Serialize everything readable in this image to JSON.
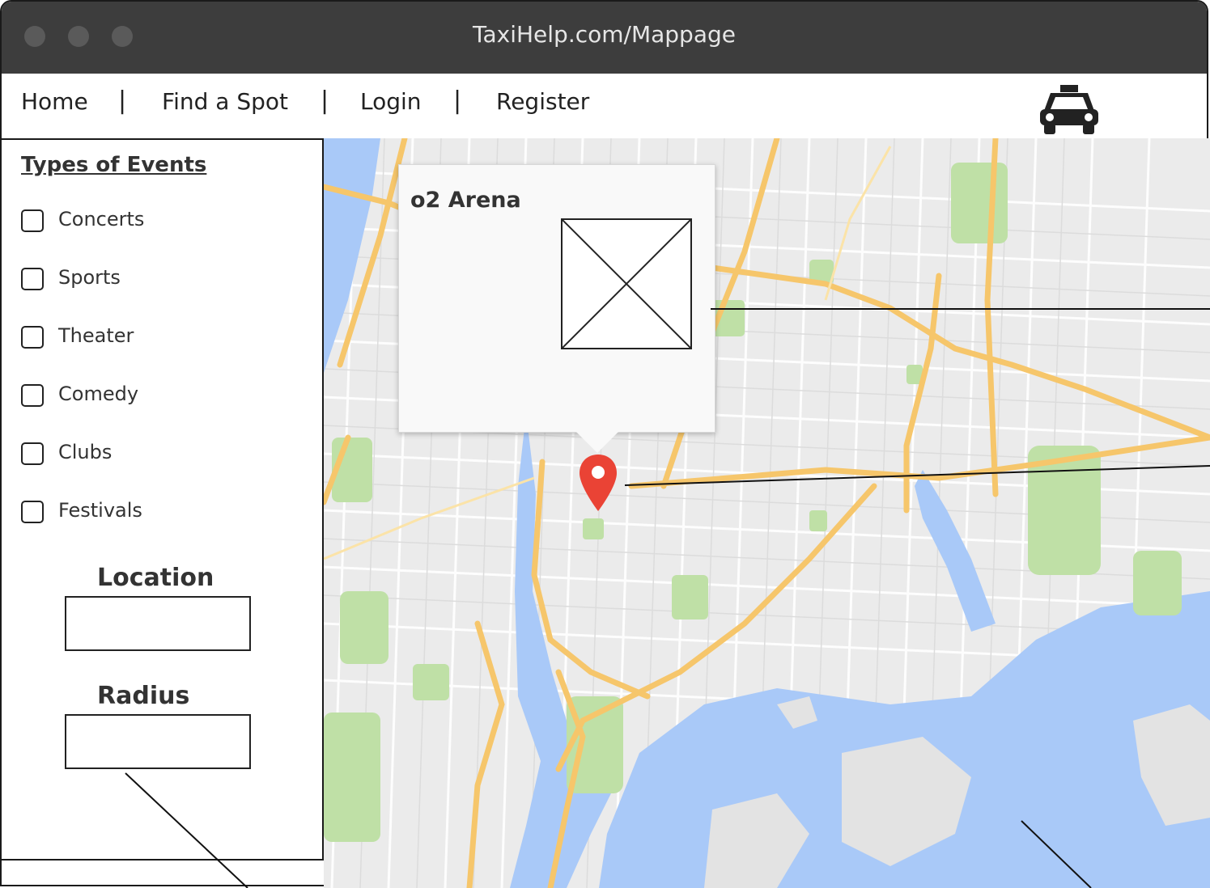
{
  "window": {
    "url": "TaxiHelp.com/Mappage"
  },
  "nav": {
    "home": "Home",
    "find_spot": "Find a Spot",
    "login": "Login",
    "register": "Register",
    "separator": "|",
    "logo_icon": "taxi-icon"
  },
  "sidebar": {
    "title": "Types of Events",
    "event_types": [
      "Concerts",
      "Sports",
      "Theater",
      "Comedy",
      "Clubs",
      "Festivals"
    ],
    "location_label": "Location",
    "location_value": "",
    "radius_label": "Radius",
    "radius_value": ""
  },
  "map": {
    "popup": {
      "title": "o2 Arena",
      "image_icon": "image-placeholder-icon"
    },
    "pin_icon": "map-pin-icon",
    "colors": {
      "water": "#a9c9f8",
      "park": "#bfe0a6",
      "road": "#f6c66b",
      "land": "#e9e9e9",
      "pin": "#ea4335"
    }
  }
}
